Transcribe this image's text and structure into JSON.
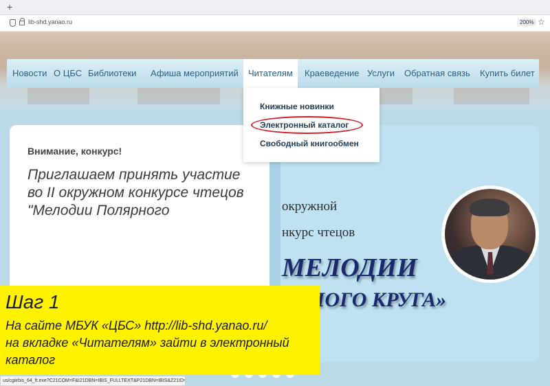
{
  "browser": {
    "new_tab_symbol": "+",
    "url": "lib-shd.yanao.ru",
    "zoom": "200%",
    "status_url": "us/cgiirbis_64_ft.exe?C21COM=F&I21DBN=IBIS_FULLTEXT&P21DBN=IBIS&Z21ID=&S21CNR=5"
  },
  "nav": {
    "items": [
      "Новости",
      "О ЦБС",
      "Библиотеки",
      "Афиша мероприятий",
      "Читателям",
      "Краеведение",
      "Услуги",
      "Обратная связь",
      "Купить билет"
    ],
    "active": "Читателям"
  },
  "dropdown": {
    "items": [
      "Книжные новинки",
      "Электронный каталог",
      "Свободный книгообмен"
    ],
    "highlighted": "Электронный каталог",
    "highlight_color": "#d21f2a"
  },
  "card": {
    "note": "Внимание, конкурс!",
    "text": "Приглашаем принять участие во II окружном конкурсе чтецов \"Мелодии Полярного"
  },
  "banner": {
    "line1": "окружной",
    "line2": "нкурс чтецов",
    "line3": "МЕЛОДИИ",
    "line4": "ЯРНОГО КРУГА»",
    "text_color": "#1a2a6e"
  },
  "slider_dots": 5,
  "overlay": {
    "title": "Шаг 1",
    "line1": "На сайте МБУК «ЦБС»  http://lib-shd.yanao.ru/",
    "line2": "на вкладке «Читателям» зайти в электронный",
    "line3": "каталог",
    "background": "#fff200"
  },
  "icons": [
    "shield-icon",
    "lock-icon",
    "star-icon"
  ]
}
